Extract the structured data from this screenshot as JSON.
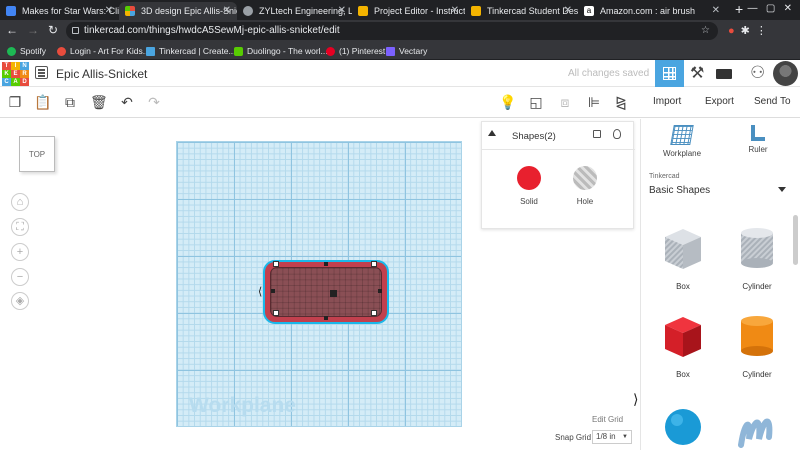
{
  "browser": {
    "tabs": [
      {
        "title": "Makes for Star Wars: Cli",
        "favicon_color": "#4285f4"
      },
      {
        "title": "3D design Epic Allis-Snic",
        "favicon_color": "#e84c3d"
      },
      {
        "title": "ZYLtech Engineering, LL",
        "favicon_color": "#9aa0a6"
      },
      {
        "title": "Project Editor - Instructal",
        "favicon_color": "#f4b400"
      },
      {
        "title": "Tinkercad Student Design",
        "favicon_color": "#f4b400"
      },
      {
        "title": "Amazon.com : air brush",
        "favicon_color": "#ffffff"
      }
    ],
    "url": "tinkercad.com/things/hwdcA5SewMj-epic-allis-snicket/edit",
    "bookmarks": [
      {
        "label": "Spotify",
        "favicon_color": "#1db954"
      },
      {
        "label": "Login - Art For Kids...",
        "favicon_color": "#e84c3d"
      },
      {
        "label": "Tinkercad | Create...",
        "favicon_color": "#4aa5e0"
      },
      {
        "label": "Duolingo - The worl...",
        "favicon_color": "#58cc02"
      },
      {
        "label": "(1) Pinterest",
        "favicon_color": "#e60023"
      },
      {
        "label": "Vectary",
        "favicon_color": "#7b61ff"
      }
    ]
  },
  "header": {
    "logo_letters": [
      "T",
      "I",
      "N",
      "K",
      "E",
      "R",
      "C",
      "A",
      "D"
    ],
    "design_title": "Epic Allis-Snicket",
    "save_status": "All changes saved"
  },
  "toolbar": {
    "import_label": "Import",
    "export_label": "Export",
    "send_to_label": "Send To"
  },
  "viewport": {
    "view_cube_label": "TOP",
    "workplane_label": "Workplane",
    "edit_grid_label": "Edit Grid",
    "snap_grid_label": "Snap Grid",
    "snap_grid_value": "1/8 in"
  },
  "inspector": {
    "title": "Shapes(2)",
    "solid_label": "Solid",
    "hole_label": "Hole",
    "solid_color": "#e8202e"
  },
  "panel": {
    "workplane_label": "Workplane",
    "ruler_label": "Ruler",
    "library_source": "Tinkercad",
    "library_name": "Basic Shapes",
    "shapes": [
      {
        "label": "Box",
        "kind": "box-hole"
      },
      {
        "label": "Cylinder",
        "kind": "cylinder-hole"
      },
      {
        "label": "Box",
        "kind": "box-solid"
      },
      {
        "label": "Cylinder",
        "kind": "cylinder-solid"
      },
      {
        "label": "",
        "kind": "sphere"
      },
      {
        "label": "",
        "kind": "scribble"
      }
    ]
  }
}
